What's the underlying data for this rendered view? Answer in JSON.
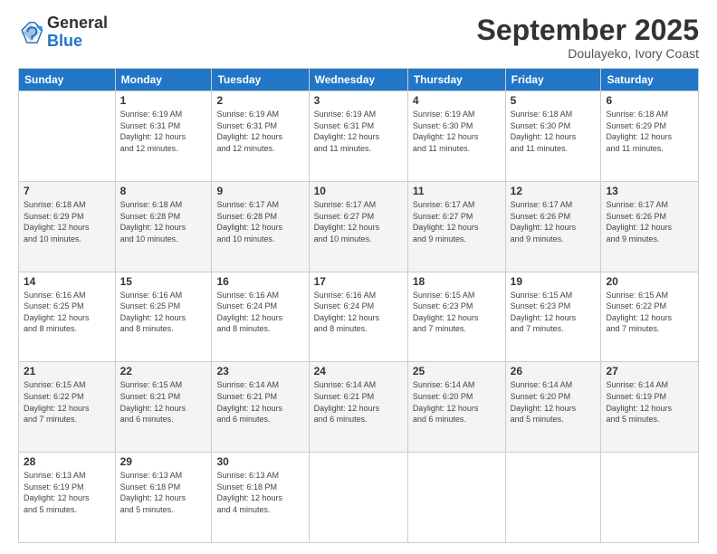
{
  "logo": {
    "line1": "General",
    "line2": "Blue"
  },
  "header": {
    "month": "September 2025",
    "location": "Doulayeko, Ivory Coast"
  },
  "weekdays": [
    "Sunday",
    "Monday",
    "Tuesday",
    "Wednesday",
    "Thursday",
    "Friday",
    "Saturday"
  ],
  "weeks": [
    [
      {
        "day": "",
        "info": ""
      },
      {
        "day": "1",
        "info": "Sunrise: 6:19 AM\nSunset: 6:31 PM\nDaylight: 12 hours\nand 12 minutes."
      },
      {
        "day": "2",
        "info": "Sunrise: 6:19 AM\nSunset: 6:31 PM\nDaylight: 12 hours\nand 12 minutes."
      },
      {
        "day": "3",
        "info": "Sunrise: 6:19 AM\nSunset: 6:31 PM\nDaylight: 12 hours\nand 11 minutes."
      },
      {
        "day": "4",
        "info": "Sunrise: 6:19 AM\nSunset: 6:30 PM\nDaylight: 12 hours\nand 11 minutes."
      },
      {
        "day": "5",
        "info": "Sunrise: 6:18 AM\nSunset: 6:30 PM\nDaylight: 12 hours\nand 11 minutes."
      },
      {
        "day": "6",
        "info": "Sunrise: 6:18 AM\nSunset: 6:29 PM\nDaylight: 12 hours\nand 11 minutes."
      }
    ],
    [
      {
        "day": "7",
        "info": "Sunrise: 6:18 AM\nSunset: 6:29 PM\nDaylight: 12 hours\nand 10 minutes."
      },
      {
        "day": "8",
        "info": "Sunrise: 6:18 AM\nSunset: 6:28 PM\nDaylight: 12 hours\nand 10 minutes."
      },
      {
        "day": "9",
        "info": "Sunrise: 6:17 AM\nSunset: 6:28 PM\nDaylight: 12 hours\nand 10 minutes."
      },
      {
        "day": "10",
        "info": "Sunrise: 6:17 AM\nSunset: 6:27 PM\nDaylight: 12 hours\nand 10 minutes."
      },
      {
        "day": "11",
        "info": "Sunrise: 6:17 AM\nSunset: 6:27 PM\nDaylight: 12 hours\nand 9 minutes."
      },
      {
        "day": "12",
        "info": "Sunrise: 6:17 AM\nSunset: 6:26 PM\nDaylight: 12 hours\nand 9 minutes."
      },
      {
        "day": "13",
        "info": "Sunrise: 6:17 AM\nSunset: 6:26 PM\nDaylight: 12 hours\nand 9 minutes."
      }
    ],
    [
      {
        "day": "14",
        "info": "Sunrise: 6:16 AM\nSunset: 6:25 PM\nDaylight: 12 hours\nand 8 minutes."
      },
      {
        "day": "15",
        "info": "Sunrise: 6:16 AM\nSunset: 6:25 PM\nDaylight: 12 hours\nand 8 minutes."
      },
      {
        "day": "16",
        "info": "Sunrise: 6:16 AM\nSunset: 6:24 PM\nDaylight: 12 hours\nand 8 minutes."
      },
      {
        "day": "17",
        "info": "Sunrise: 6:16 AM\nSunset: 6:24 PM\nDaylight: 12 hours\nand 8 minutes."
      },
      {
        "day": "18",
        "info": "Sunrise: 6:15 AM\nSunset: 6:23 PM\nDaylight: 12 hours\nand 7 minutes."
      },
      {
        "day": "19",
        "info": "Sunrise: 6:15 AM\nSunset: 6:23 PM\nDaylight: 12 hours\nand 7 minutes."
      },
      {
        "day": "20",
        "info": "Sunrise: 6:15 AM\nSunset: 6:22 PM\nDaylight: 12 hours\nand 7 minutes."
      }
    ],
    [
      {
        "day": "21",
        "info": "Sunrise: 6:15 AM\nSunset: 6:22 PM\nDaylight: 12 hours\nand 7 minutes."
      },
      {
        "day": "22",
        "info": "Sunrise: 6:15 AM\nSunset: 6:21 PM\nDaylight: 12 hours\nand 6 minutes."
      },
      {
        "day": "23",
        "info": "Sunrise: 6:14 AM\nSunset: 6:21 PM\nDaylight: 12 hours\nand 6 minutes."
      },
      {
        "day": "24",
        "info": "Sunrise: 6:14 AM\nSunset: 6:21 PM\nDaylight: 12 hours\nand 6 minutes."
      },
      {
        "day": "25",
        "info": "Sunrise: 6:14 AM\nSunset: 6:20 PM\nDaylight: 12 hours\nand 6 minutes."
      },
      {
        "day": "26",
        "info": "Sunrise: 6:14 AM\nSunset: 6:20 PM\nDaylight: 12 hours\nand 5 minutes."
      },
      {
        "day": "27",
        "info": "Sunrise: 6:14 AM\nSunset: 6:19 PM\nDaylight: 12 hours\nand 5 minutes."
      }
    ],
    [
      {
        "day": "28",
        "info": "Sunrise: 6:13 AM\nSunset: 6:19 PM\nDaylight: 12 hours\nand 5 minutes."
      },
      {
        "day": "29",
        "info": "Sunrise: 6:13 AM\nSunset: 6:18 PM\nDaylight: 12 hours\nand 5 minutes."
      },
      {
        "day": "30",
        "info": "Sunrise: 6:13 AM\nSunset: 6:18 PM\nDaylight: 12 hours\nand 4 minutes."
      },
      {
        "day": "",
        "info": ""
      },
      {
        "day": "",
        "info": ""
      },
      {
        "day": "",
        "info": ""
      },
      {
        "day": "",
        "info": ""
      }
    ]
  ]
}
